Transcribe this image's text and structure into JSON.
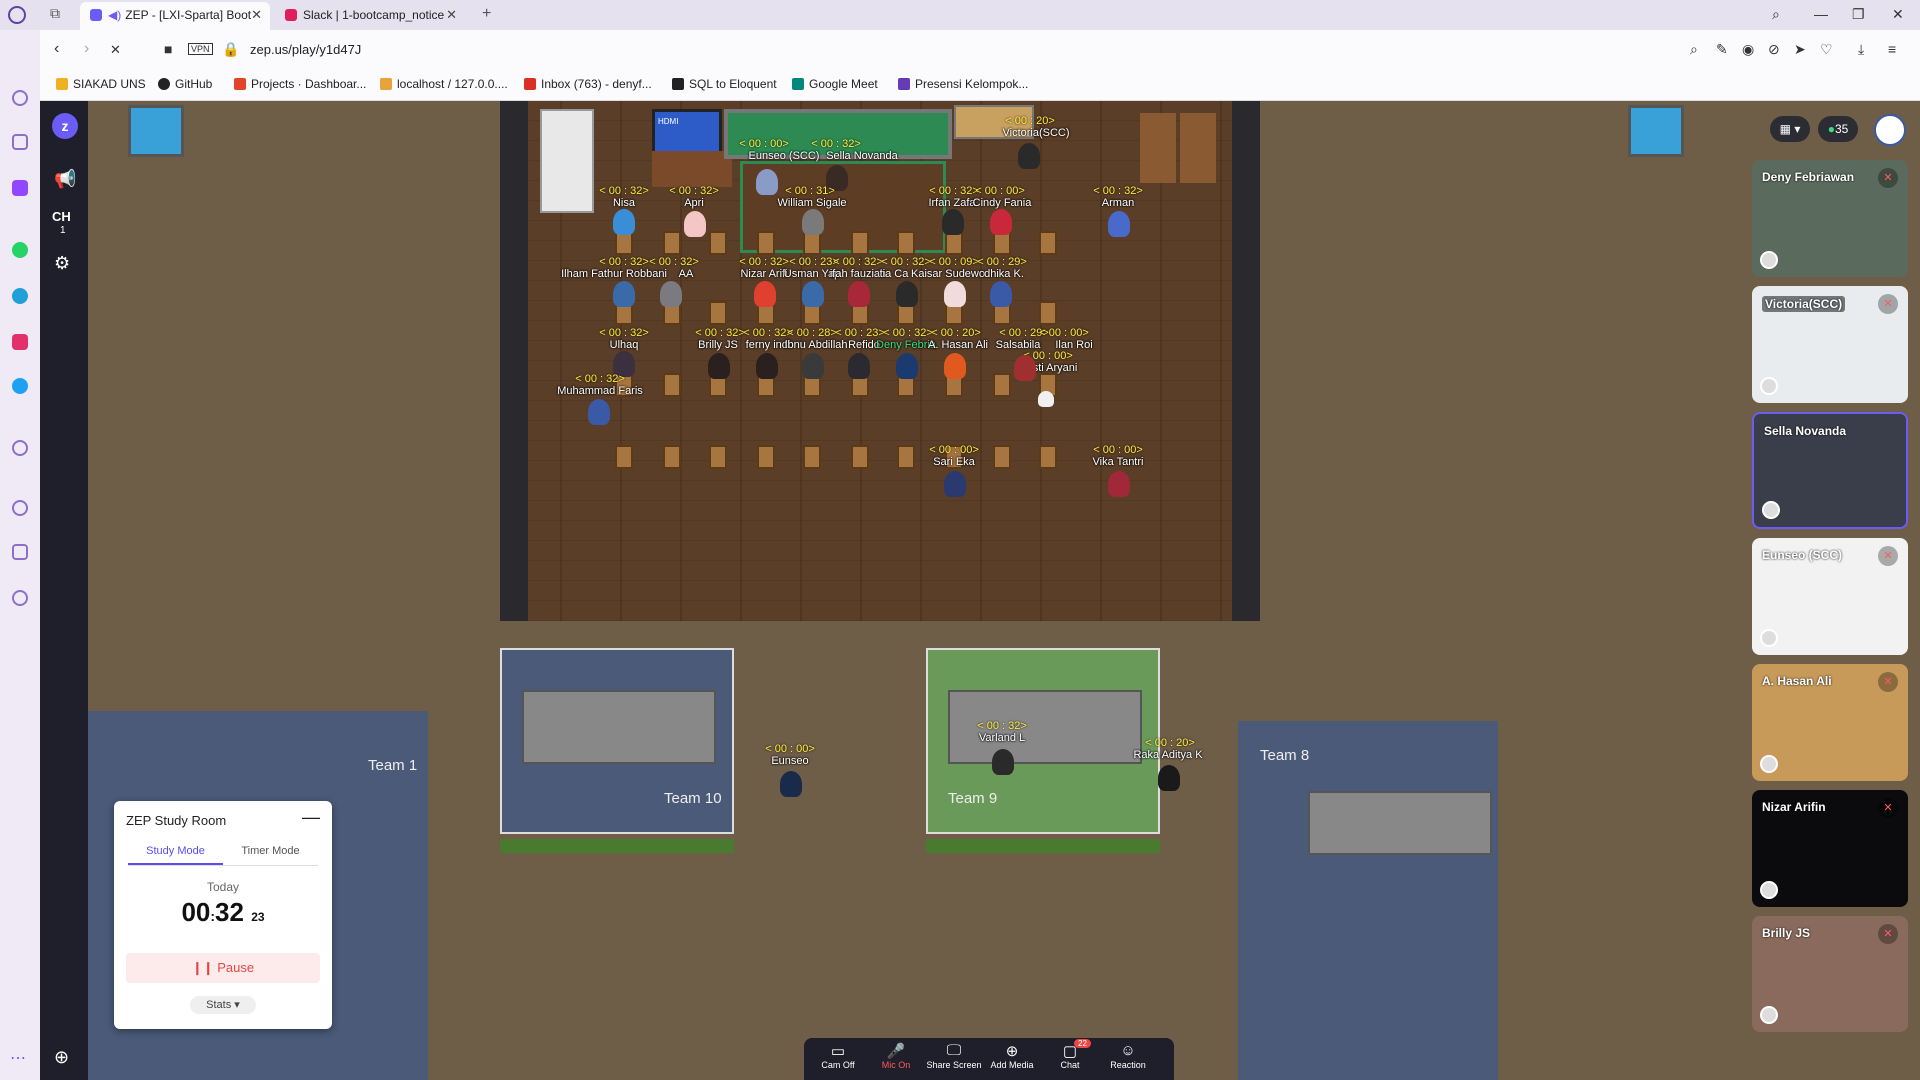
{
  "browser": {
    "tabs": [
      {
        "title": "ZEP - [LXI-Sparta] Boot",
        "active": true
      },
      {
        "title": "Slack | 1-bootcamp_notice",
        "active": false
      }
    ],
    "url": "zep.us/play/y1d47J",
    "vpn_label": "VPN",
    "bookmarks": [
      "SIAKAD UNS",
      "GitHub",
      "Projects · Dashboar...",
      "localhost / 127.0.0....",
      "Inbox (763) - denyf...",
      "SQL to Eloquent",
      "Google Meet",
      "Presensi Kelompok..."
    ]
  },
  "app": {
    "logo": "z",
    "channel": {
      "label": "CH",
      "number": "1"
    },
    "participant_count": "35"
  },
  "classroom": {
    "tv_label": "HDMI",
    "players": [
      {
        "name": "Victoria(SCC)",
        "time": "< 00 : 20>"
      },
      {
        "name": "Eunseo (SCC)",
        "time": "< 00 : 00>"
      },
      {
        "name": "Sella Novanda",
        "time": "< 00 : 32>"
      },
      {
        "name": "William Sigale",
        "time": "< 00 : 31>"
      },
      {
        "name": "Nisa",
        "time": "< 00 : 32>"
      },
      {
        "name": "Apri",
        "time": "< 00 : 32>"
      },
      {
        "name": "Irfan Zafa",
        "time": "< 00 : 32>"
      },
      {
        "name": "Cindy Fania",
        "time": "< 00 : 00>"
      },
      {
        "name": "Arman",
        "time": "< 00 : 32>"
      },
      {
        "name": "Ilham Fathur Robbani",
        "time": "< 00 : 32>"
      },
      {
        "name": "AA",
        "time": "< 00 : 32>"
      },
      {
        "name": "Nizar Arifi",
        "time": "< 00 : 32>"
      },
      {
        "name": "Usman Yap",
        "time": "< 00 : 23>"
      },
      {
        "name": "ifah fauziah",
        "time": "< 00 : 32>"
      },
      {
        "name": "tia Ca",
        "time": "< 00 : 32>"
      },
      {
        "name": "Kaisar Sudewo",
        "time": "< 00 : 09>"
      },
      {
        "name": "dhika K.",
        "time": "< 00 : 29>"
      },
      {
        "name": "Ulhaq",
        "time": "< 00 : 32>"
      },
      {
        "name": "Brilly JS",
        "time": "< 00 : 32>"
      },
      {
        "name": "ferny indi",
        "time": "< 00 : 32>"
      },
      {
        "name": "Ibnu Abdillah",
        "time": "< 00 : 28>"
      },
      {
        "name": "Refido",
        "time": "< 00 : 23>"
      },
      {
        "name": "Deny Febria",
        "time": "< 00 : 32>"
      },
      {
        "name": "A. Hasan Ali",
        "time": "< 00 : 20>"
      },
      {
        "name": "Salsabila",
        "time": "< 00 : 29>"
      },
      {
        "name": "Ilan Roi",
        "time": "< 00 : 00>"
      },
      {
        "name": "Resti Aryani",
        "time": "< 00 : 00>"
      },
      {
        "name": "Muhammad Faris",
        "time": "< 00 : 32>"
      },
      {
        "name": "Sari Eka",
        "time": "< 00 : 00>"
      },
      {
        "name": "Vika Tantri",
        "time": "< 00 : 00>"
      }
    ]
  },
  "teams": [
    {
      "label": "Team 1"
    },
    {
      "label": "Team 10"
    },
    {
      "label": "Team 9"
    },
    {
      "label": "Team 8"
    }
  ],
  "hallway_players": [
    {
      "name": "Eunseo",
      "time": "< 00 : 00>"
    },
    {
      "name": "Varland L",
      "time": "< 00 : 32>"
    },
    {
      "name": "Raka Aditya K",
      "time": "< 00 : 20>"
    }
  ],
  "study_room": {
    "title": "ZEP Study Room",
    "tab_study": "Study Mode",
    "tab_timer": "Timer Mode",
    "today": "Today",
    "hours": "00",
    "minutes": "32",
    "seconds": "23",
    "pause": "Pause",
    "stats": "Stats"
  },
  "videos": [
    {
      "name": "Deny Febriawan",
      "bg": "#5a6a5c"
    },
    {
      "name": "Victoria(SCC)",
      "bg": "#e9ecef"
    },
    {
      "name": "Sella Novanda",
      "bg": "#3a3e4a"
    },
    {
      "name": "Eunseo (SCC)",
      "bg": "#f2f2f2"
    },
    {
      "name": "A. Hasan Ali",
      "bg": "#c79a5a"
    },
    {
      "name": "Nizar Arifin",
      "bg": "#0b0b0e"
    },
    {
      "name": "Brilly JS",
      "bg": "#8a6a5c"
    }
  ],
  "toolbar": {
    "cam": "Cam Off",
    "mic": "Mic On",
    "share": "Share Screen",
    "media": "Add Media",
    "chat": "Chat",
    "chat_badge": "22",
    "reaction": "Reaction"
  }
}
